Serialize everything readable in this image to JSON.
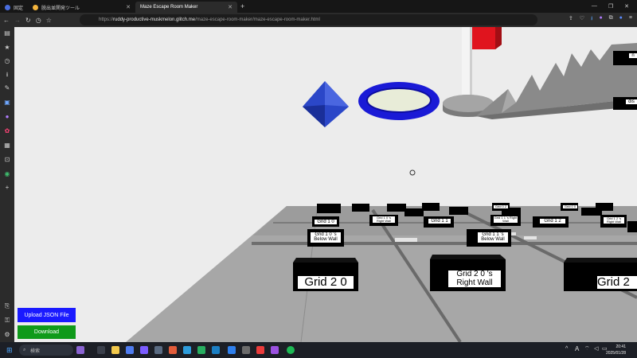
{
  "tabs": [
    {
      "label": "脱出並関発ツール",
      "active": false
    },
    {
      "label": "Maze Escape Room Maker",
      "active": true
    }
  ],
  "pinned_tab_label": "固定",
  "url": {
    "prefix": "https://",
    "domain": "ruddy-productive-muskmelon.glitch.me",
    "path": "/maze-escape-room-maker/maze-escape-room-maker.html"
  },
  "grid_labels": {
    "g20": "Grid 2 0",
    "g20_right": "Grid 2 0 's Right Wall",
    "g2_partial": "Grid 2",
    "g10_below": "Grid 1 0 's Below Wall",
    "g11_below": "Grid 1 1 's Below Wall",
    "g10": "Grid 1 0",
    "g11": "Grid 1 1",
    "g10_right": "Grid 1 0 's Right Wall",
    "g11_right": "Grid 1 1 's Right Wall",
    "g12": "Grid 1 2",
    "g12_right": "Grid 1 2 's Right Wall",
    "g02": "Grid 0 2",
    "g00": "Grid 0 0",
    "far_partial_top": "n",
    "far_partial_dis": "dis"
  },
  "buttons": {
    "upload": "Upload JSON File",
    "download": "Download"
  },
  "taskbar": {
    "search_placeholder": "検索",
    "time": "20:41",
    "date": "2025/01/28",
    "ime": "A"
  },
  "colors": {
    "upload_button": "#1a1aff",
    "download_button": "#0f9a1a",
    "scene_background": "#ececec",
    "floor": "#a7a7a7",
    "octahedron": "#2b47c8",
    "torus": "#1a1ad6",
    "flag": "#e0141e"
  },
  "icons": [
    "back-icon",
    "forward-icon",
    "reload-icon",
    "history-icon",
    "lock-icon",
    "share-icon",
    "download-icon",
    "extensions-icon",
    "profile-icon",
    "menu-icon"
  ]
}
